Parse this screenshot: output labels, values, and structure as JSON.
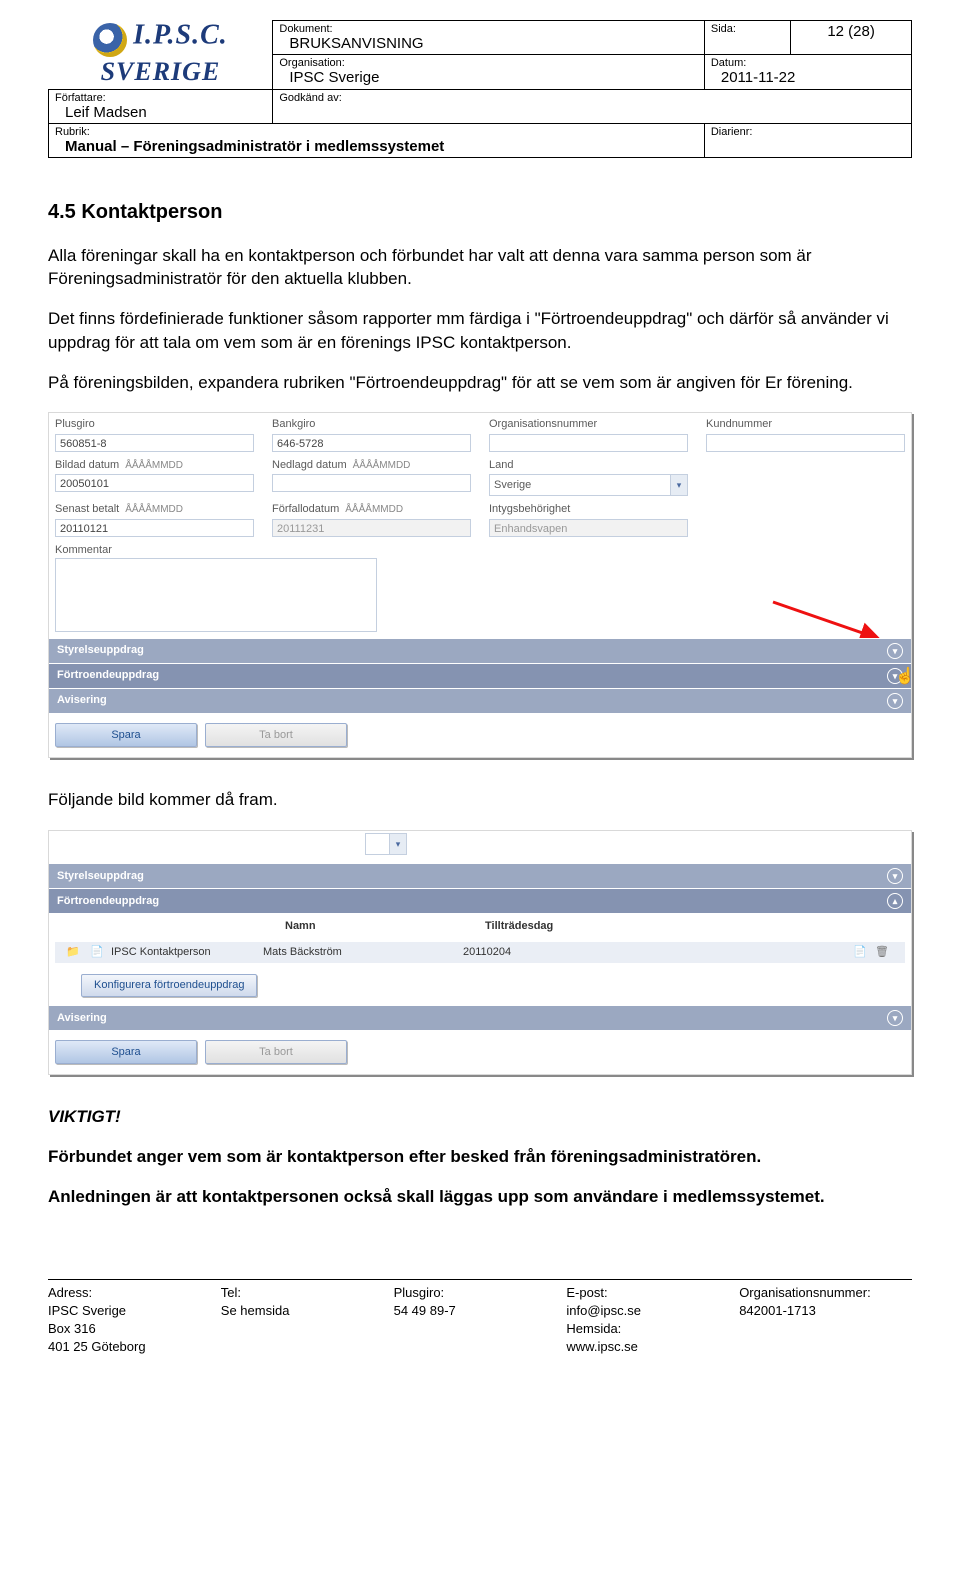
{
  "header": {
    "logo_top": "I.P.S.C.",
    "logo_bottom": "SVERIGE",
    "dokument_label": "Dokument:",
    "dokument": "BRUKSANVISNING",
    "sida_label": "Sida:",
    "sida": "12 (28)",
    "organisation_label": "Organisation:",
    "organisation": "IPSC Sverige",
    "datum_label": "Datum:",
    "datum": "2011-11-22",
    "forfattare_label": "Författare:",
    "forfattare": "Leif Madsen",
    "godkand_label": "Godkänd av:",
    "godkand": "",
    "rubrik_label": "Rubrik:",
    "rubrik": "Manual – Föreningsadministratör i medlemssystemet",
    "diarienr_label": "Diarienr:",
    "diarienr": ""
  },
  "section": {
    "heading": "4.5    Kontaktperson",
    "p1": "Alla föreningar skall ha en kontaktperson och förbundet har valt att denna vara samma person som är Föreningsadministratör för den aktuella klubben.",
    "p2": "Det finns fördefinierade funktioner såsom rapporter mm färdiga i \"Förtroendeuppdrag\" och därför så använder vi uppdrag för att tala om vem som är en förenings IPSC kontaktperson.",
    "p3": "På föreningsbilden, expandera rubriken \"Förtroendeuppdrag\" för att se vem som är angiven för Er förening.",
    "p4": "Följande bild kommer då fram.",
    "viktigt": "VIKTIGT!",
    "p5": "Förbundet anger vem som är kontaktperson efter besked från föreningsadministratören.",
    "p6": "Anledningen är att kontaktpersonen också skall läggas upp som användare i medlemssystemet."
  },
  "form1": {
    "plusgiro_label": "Plusgiro",
    "plusgiro": "560851-8",
    "bankgiro_label": "Bankgiro",
    "bankgiro": "646-5728",
    "orgnr_label": "Organisationsnummer",
    "orgnr": "",
    "kundnr_label": "Kundnummer",
    "kundnr": "",
    "bildad_label": "Bildad datum",
    "bildad": "20050101",
    "nedlagd_label": "Nedlagd datum",
    "nedlagd": "",
    "land_label": "Land",
    "land": "Sverige",
    "hint": "ÅÅÅÅMMDD",
    "senast_label": "Senast betalt",
    "senast": "20110121",
    "forfallo_label": "Förfallodatum",
    "forfallo": "20111231",
    "intyg_label": "Intygsbehörighet",
    "intyg": "Enhandsvapen",
    "kommentar_label": "Kommentar",
    "bar1": "Styrelseuppdrag",
    "bar2": "Förtroendeuppdrag",
    "bar3": "Avisering",
    "btn_spara": "Spara",
    "btn_tabort": "Ta bort"
  },
  "form2": {
    "bar1": "Styrelseuppdrag",
    "bar2": "Förtroendeuppdrag",
    "col_namn": "Namn",
    "col_till": "Tillträdesdag",
    "row_role": "IPSC Kontaktperson",
    "row_name": "Mats Bäckström",
    "row_date": "20110204",
    "btn_konf": "Konfigurera förtroendeuppdrag",
    "bar3": "Avisering",
    "btn_spara": "Spara",
    "btn_tabort": "Ta bort"
  },
  "footer": {
    "adress_label": "Adress:",
    "adress_1": "IPSC Sverige",
    "adress_2": "Box 316",
    "adress_3": "401 25 Göteborg",
    "tel_label": "Tel:",
    "tel": "Se hemsida",
    "plusgiro_label": "Plusgiro:",
    "plusgiro": "54 49 89-7",
    "epost_label": "E-post:",
    "epost": "info@ipsc.se",
    "hemsida_label": "Hemsida:",
    "hemsida": "www.ipsc.se",
    "orgnr_label": "Organisationsnummer:",
    "orgnr": "842001-1713"
  }
}
